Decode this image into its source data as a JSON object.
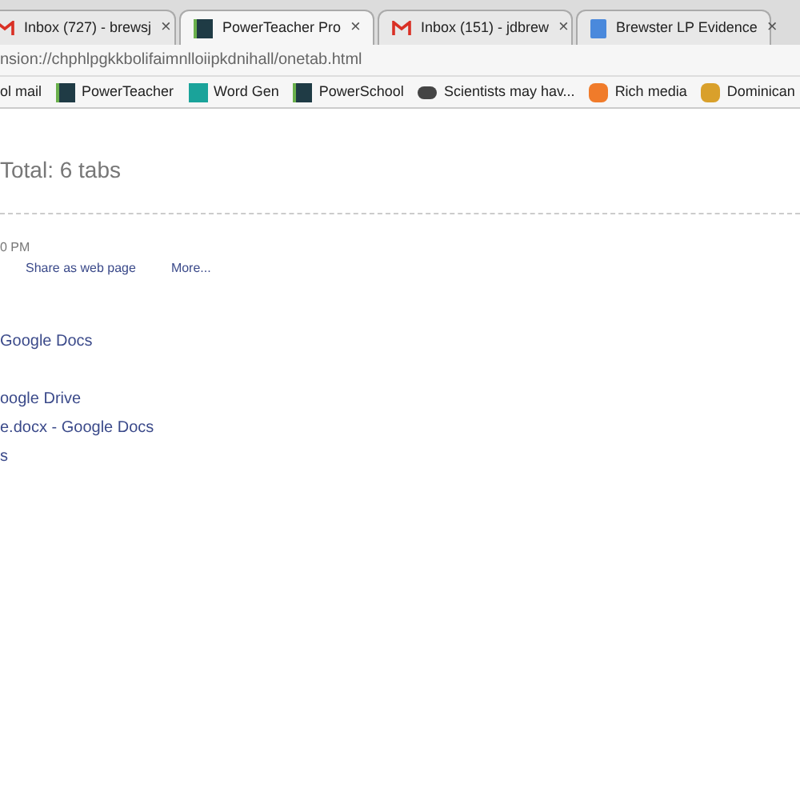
{
  "tabs": [
    {
      "title": "Inbox (727) - brewsj",
      "kind": "mail",
      "close": "×",
      "selected": false
    },
    {
      "title": "PowerTeacher Pro",
      "kind": "app",
      "close": "×",
      "selected": true
    },
    {
      "title": "Inbox (151) - jdbrew",
      "kind": "mail",
      "close": "×",
      "selected": false
    },
    {
      "title": "Brewster LP Evidence",
      "kind": "doc",
      "close": "×",
      "selected": false
    }
  ],
  "address": "nsion://chphlpgkkbolifaimnlloiipkdnihall/onetab.html",
  "bookmarks": [
    {
      "label": "ol mail",
      "kind": "plain"
    },
    {
      "label": "PowerTeacher",
      "kind": "app"
    },
    {
      "label": "Word Gen",
      "kind": "teal"
    },
    {
      "label": "PowerSchool",
      "kind": "app"
    },
    {
      "label": "Scientists may hav...",
      "kind": "dark"
    },
    {
      "label": "Rich media",
      "kind": "orange"
    },
    {
      "label": "Dominican",
      "kind": "gold"
    }
  ],
  "total": "Total: 6 tabs",
  "group": {
    "time": "0 PM",
    "actions": [
      "Share as web page",
      "More..."
    ]
  },
  "links": [
    "Google Docs",
    "oogle Drive",
    "e.docx - Google Docs",
    "s"
  ]
}
